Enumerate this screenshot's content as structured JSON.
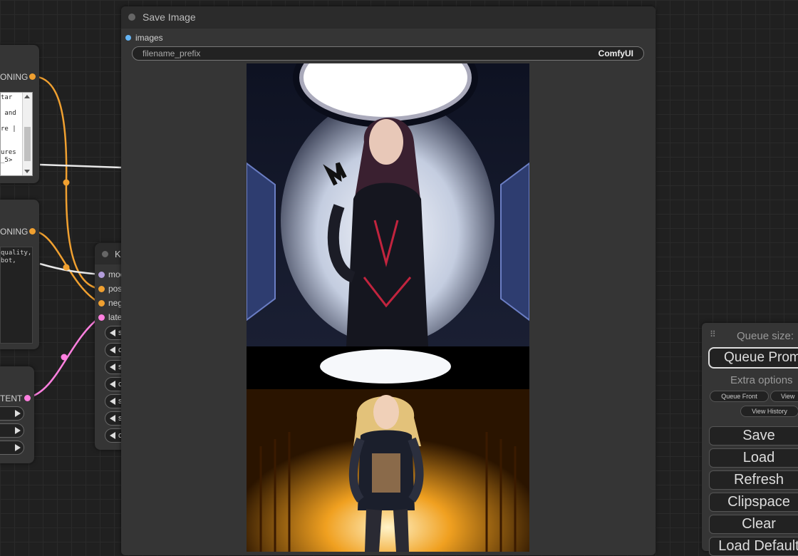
{
  "save_node": {
    "title": "Save Image",
    "input_label": "images",
    "widget_name": "filename_prefix",
    "widget_value": "ComfyUI"
  },
  "left_nodes": {
    "positive_output": "ONING",
    "positive_text": "tar\n\n and\n\nre |\n\n\nures\n_5>",
    "negative_output": "ONING",
    "negative_text": "quality,\nbot,",
    "latent_output": "TENT"
  },
  "ksampler": {
    "title": "K",
    "inputs": [
      "moc",
      "pos",
      "neg",
      "late"
    ],
    "widget_initials": [
      "s",
      "c",
      "s",
      "c",
      "s",
      "s",
      "c"
    ]
  },
  "menu": {
    "queue_size_label": "Queue size:",
    "queue_prompt": "Queue Prompt",
    "extra_options": "Extra options",
    "queue_front": "Queue Front",
    "view_queue": "View",
    "view_history": "View History",
    "save": "Save",
    "load": "Load",
    "refresh": "Refresh",
    "clipspace": "Clipspace",
    "clear": "Clear",
    "load_default": "Load Default"
  },
  "colors": {
    "clip_link": "#f0a030",
    "latent_link": "#ff80e0",
    "model_link": "#b39ddb",
    "images_dot": "#64b5f6",
    "canvas_bg": "#202020",
    "node_bg": "#353535"
  }
}
